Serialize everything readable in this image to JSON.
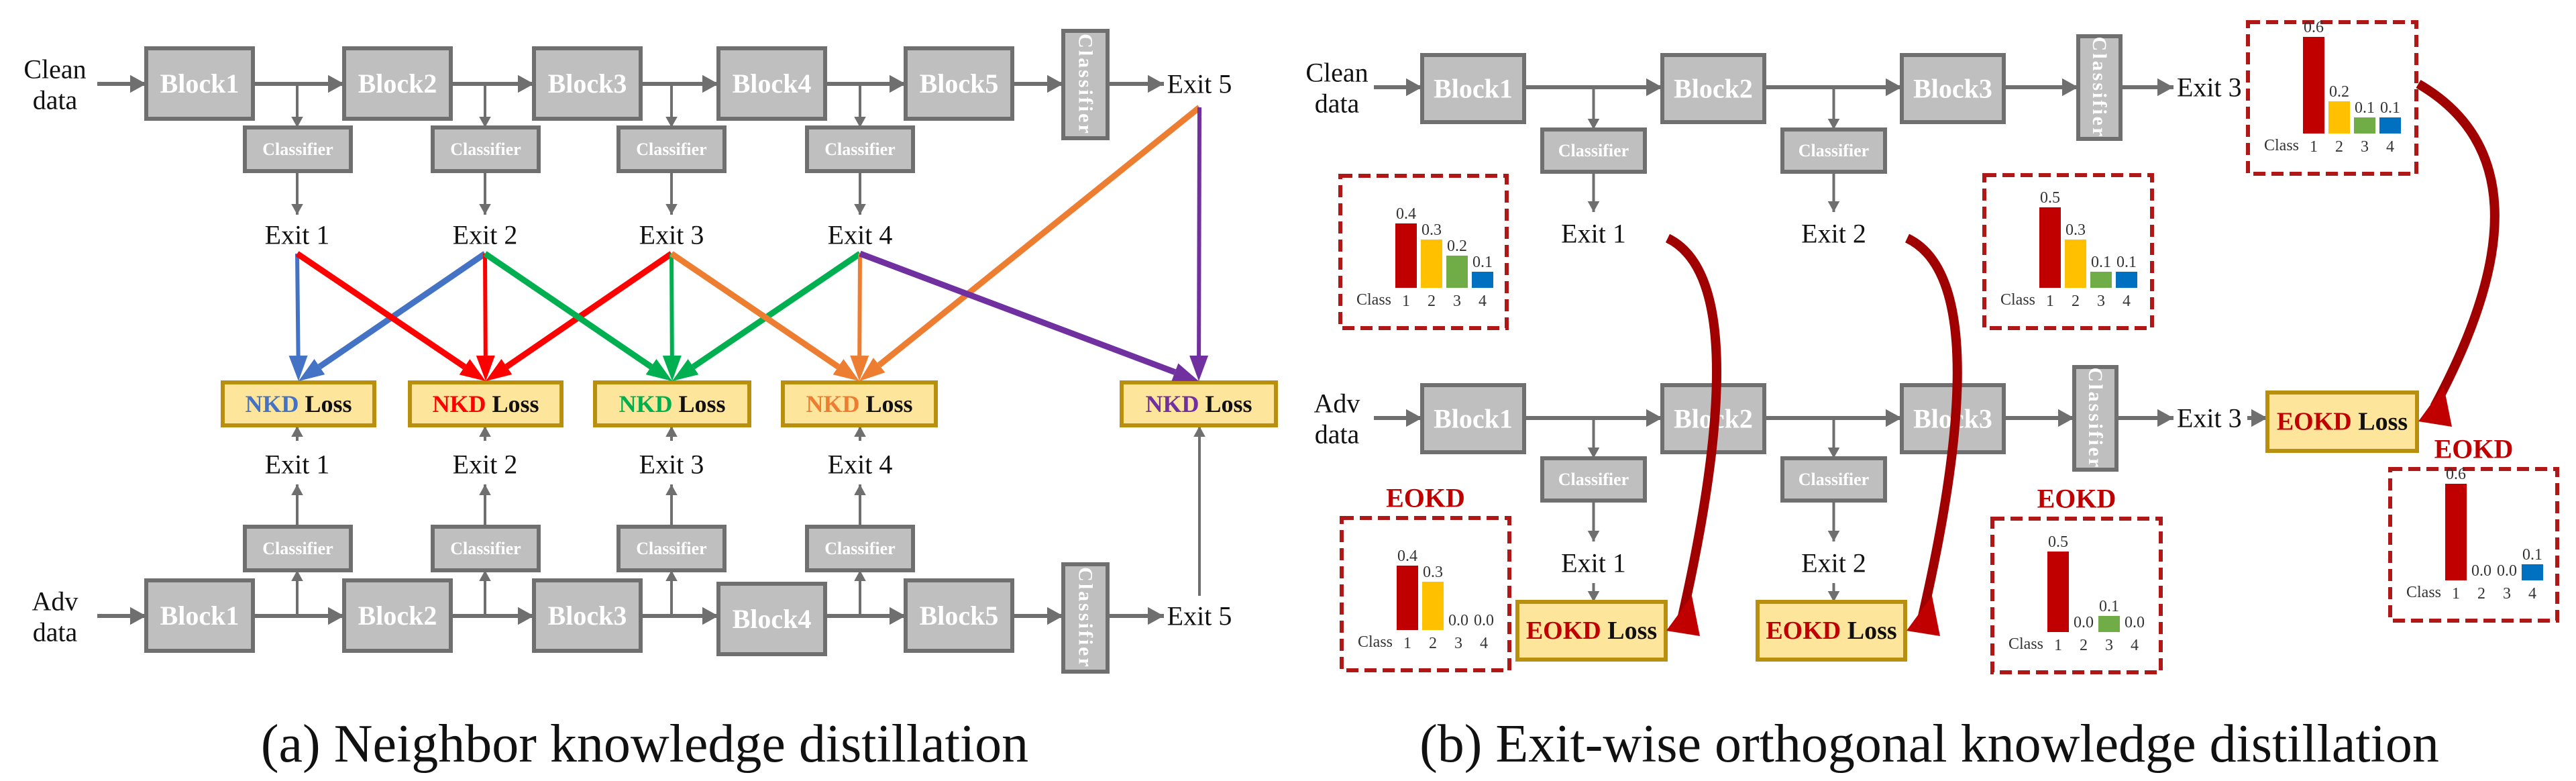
{
  "panels": {
    "a": {
      "caption": "(a) Neighbor knowledge distillation",
      "clean_input": [
        "Clean",
        "data"
      ],
      "adv_input": [
        "Adv",
        "data"
      ],
      "blocks": [
        "Block1",
        "Block2",
        "Block3",
        "Block4",
        "Block5"
      ],
      "classifier_label": "Classifier",
      "exits": [
        "Exit 1",
        "Exit 2",
        "Exit 3",
        "Exit 4",
        "Exit 5"
      ],
      "loss_prefix": "NKD",
      "loss_suffix": "Loss",
      "loss_colors": [
        "#4472c4",
        "#ff0000",
        "#00b050",
        "#ed7d31",
        "#7030a0"
      ],
      "connections": [
        {
          "from_exit": 1,
          "to_loss": 1,
          "color_index": 0
        },
        {
          "from_exit": 2,
          "to_loss": 1,
          "color_index": 0
        },
        {
          "from_exit": 1,
          "to_loss": 2,
          "color_index": 1
        },
        {
          "from_exit": 2,
          "to_loss": 2,
          "color_index": 1
        },
        {
          "from_exit": 3,
          "to_loss": 2,
          "color_index": 1
        },
        {
          "from_exit": 2,
          "to_loss": 3,
          "color_index": 2
        },
        {
          "from_exit": 3,
          "to_loss": 3,
          "color_index": 2
        },
        {
          "from_exit": 4,
          "to_loss": 3,
          "color_index": 2
        },
        {
          "from_exit": 3,
          "to_loss": 4,
          "color_index": 3
        },
        {
          "from_exit": 4,
          "to_loss": 4,
          "color_index": 3
        },
        {
          "from_exit": 5,
          "to_loss": 4,
          "color_index": 3
        },
        {
          "from_exit": 4,
          "to_loss": 5,
          "color_index": 4
        },
        {
          "from_exit": 5,
          "to_loss": 5,
          "color_index": 4
        }
      ]
    },
    "b": {
      "caption": "(b) Exit-wise orthogonal knowledge distillation",
      "clean_input": [
        "Clean",
        "data"
      ],
      "adv_input": [
        "Adv",
        "data"
      ],
      "blocks": [
        "Block1",
        "Block2",
        "Block3"
      ],
      "classifier_label": "Classifier",
      "exits": [
        "Exit 1",
        "Exit 2",
        "Exit 3"
      ],
      "loss_prefix": "EOKD",
      "loss_suffix": "Loss",
      "loss_color": "#c00000",
      "eokd_label": "EOKD",
      "class_label": "Class",
      "class_ticks": [
        "1",
        "2",
        "3",
        "4"
      ],
      "bar_colors": [
        "#c00000",
        "#ffc000",
        "#70ad47",
        "#0070c0"
      ],
      "clean_distributions": [
        {
          "exit": "Exit 1",
          "values": [
            0.4,
            0.3,
            0.2,
            0.1
          ],
          "labels": [
            "0.4",
            "0.3",
            "0.2",
            "0.1"
          ]
        },
        {
          "exit": "Exit 2",
          "values": [
            0.5,
            0.3,
            0.1,
            0.1
          ],
          "labels": [
            "0.5",
            "0.3",
            "0.1",
            "0.1"
          ]
        },
        {
          "exit": "Exit 3",
          "values": [
            0.6,
            0.2,
            0.1,
            0.1
          ],
          "labels": [
            "0.6",
            "0.2",
            "0.1",
            "0.1"
          ]
        }
      ],
      "eokd_distributions": [
        {
          "exit": "Exit 1",
          "values": [
            0.4,
            0.3,
            0.0,
            0.0
          ],
          "labels": [
            "0.4",
            "0.3",
            "0.0",
            "0.0"
          ]
        },
        {
          "exit": "Exit 2",
          "values": [
            0.5,
            0.0,
            0.1,
            0.0
          ],
          "labels": [
            "0.5",
            "0.0",
            "0.1",
            "0.0"
          ]
        },
        {
          "exit": "Exit 3",
          "values": [
            0.6,
            0.0,
            0.0,
            0.1
          ],
          "labels": [
            "0.6",
            "0.0",
            "0.0",
            "0.1"
          ]
        }
      ]
    }
  },
  "colors": {
    "block_fill": "#bfbfbf",
    "block_border": "#6f6f6f",
    "arrow_gray": "#6f6f6f",
    "loss_fill": "#fee59c",
    "loss_border": "#b8900e",
    "dash_red": "#b01818",
    "curve_red": "#a00000"
  }
}
